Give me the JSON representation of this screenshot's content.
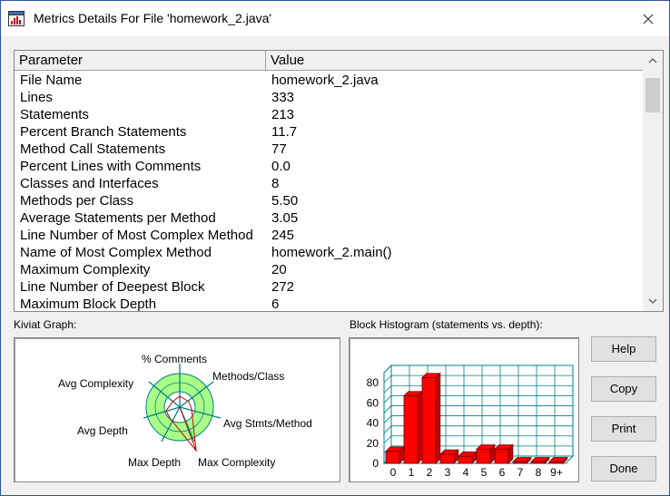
{
  "window": {
    "title": "Metrics Details For File 'homework_2.java'"
  },
  "table": {
    "columns": [
      "Parameter",
      "Value"
    ],
    "rows": [
      [
        "File Name",
        "homework_2.java"
      ],
      [
        "Lines",
        "333"
      ],
      [
        "Statements",
        "213"
      ],
      [
        "Percent Branch Statements",
        "11.7"
      ],
      [
        "Method Call Statements",
        "77"
      ],
      [
        "Percent Lines with Comments",
        "0.0"
      ],
      [
        "Classes and Interfaces",
        "8"
      ],
      [
        "Methods per Class",
        "5.50"
      ],
      [
        "Average Statements per Method",
        "3.05"
      ],
      [
        "Line Number of Most Complex Method",
        "245"
      ],
      [
        "Name of Most Complex Method",
        "homework_2.main()"
      ],
      [
        "Maximum Complexity",
        "20"
      ],
      [
        "Line Number of Deepest Block",
        "272"
      ],
      [
        "Maximum Block Depth",
        "6"
      ]
    ]
  },
  "kiviat": {
    "label": "Kiviat Graph:",
    "axes": {
      "comments": "% Comments",
      "methods_class": "Methods/Class",
      "avg_stmts": "Avg Stmts/Method",
      "max_complexity": "Max Complexity",
      "max_depth": "Max Depth",
      "avg_depth": "Avg Depth",
      "avg_complexity": "Avg Complexity"
    },
    "colors": {
      "ring": "#aaff88",
      "axis": "#008080",
      "polygon": "#cc0000"
    }
  },
  "histogram": {
    "label": "Block Histogram (statements vs. depth):"
  },
  "chart_data": {
    "type": "bar",
    "title": "Block Histogram (statements vs. depth):",
    "categories": [
      "0",
      "1",
      "2",
      "3",
      "4",
      "5",
      "6",
      "7",
      "8",
      "9+"
    ],
    "values": [
      12,
      67,
      85,
      9,
      7,
      14,
      14,
      0,
      0,
      0
    ],
    "ylim": [
      0,
      90
    ],
    "yticks": [
      "0",
      "20",
      "40",
      "60",
      "80"
    ],
    "grid": true,
    "bar_color": "#ff0000",
    "grid_color": "#008080"
  },
  "buttons": {
    "help": "Help",
    "copy": "Copy",
    "print": "Print",
    "done": "Done"
  }
}
